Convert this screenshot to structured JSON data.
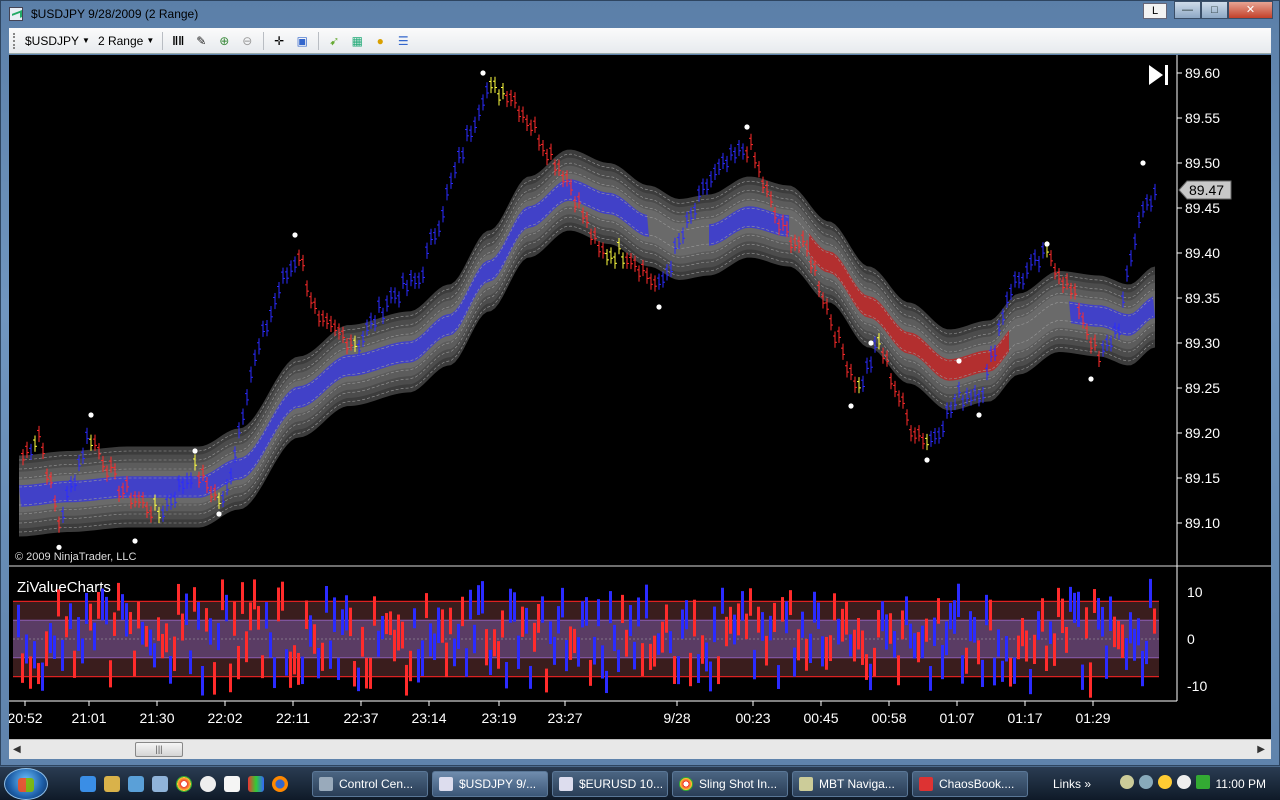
{
  "window": {
    "title": "$USDJPY  9/28/2009 (2 Range)",
    "layout_btn": "L",
    "min_symbol": "—",
    "max_symbol": "□",
    "close_symbol": "✕"
  },
  "toolbar": {
    "instrument": "$USDJPY",
    "period": "2 Range",
    "icons": [
      "bar-type-icon",
      "pencil-icon",
      "zoom-in-icon",
      "zoom-out-icon",
      "crosshair-icon",
      "data-box-icon",
      "strategy-icon",
      "indicators-icon",
      "chart-trader-icon",
      "properties-icon"
    ]
  },
  "chart": {
    "copyright": "© 2009 NinjaTrader, LLC",
    "current_price": "89.47",
    "price_ticks": [
      "89.60",
      "89.55",
      "89.50",
      "89.45",
      "89.40",
      "89.35",
      "89.30",
      "89.25",
      "89.20",
      "89.15",
      "89.10"
    ],
    "price_tick_values": [
      89.6,
      89.55,
      89.5,
      89.45,
      89.4,
      89.35,
      89.3,
      89.25,
      89.2,
      89.15,
      89.1
    ],
    "time_labels": [
      "20:52",
      "21:01",
      "21:30",
      "22:02",
      "22:11",
      "22:37",
      "23:14",
      "23:19",
      "23:27",
      "9/28",
      "00:23",
      "00:45",
      "00:58",
      "01:07",
      "01:17",
      "01:29"
    ],
    "indicator_title": "ZiValueCharts",
    "indicator_ticks": [
      "10",
      "0",
      "-10"
    ],
    "indicator_tick_values": [
      10,
      0,
      -10
    ],
    "colors": {
      "up_bar": "#2b2bff",
      "down_bar": "#ff2b2b",
      "neutral_bar": "#ffff40",
      "band_gray": "#6e6e6e",
      "band_blue": "#3a3ad8",
      "band_red": "#c02525",
      "background": "#000000",
      "axis_text": "#ffffff",
      "value_zone": "#5a3c64"
    }
  },
  "scrollbar": {
    "left_arrow": "◀",
    "right_arrow": "▶",
    "thumb": "|||"
  },
  "taskbar": {
    "buttons": [
      {
        "label": "Control Cen...",
        "icon": "settings-icon"
      },
      {
        "label": "$USDJPY  9/...",
        "icon": "chart-icon"
      },
      {
        "label": "$EURUSD  10...",
        "icon": "chart-icon"
      },
      {
        "label": "Sling Shot In...",
        "icon": "chrome-icon"
      },
      {
        "label": "MBT Naviga...",
        "icon": "navigator-icon"
      },
      {
        "label": "ChaosBook....",
        "icon": "pdf-icon"
      }
    ],
    "links": "Links",
    "links_arrows": "»",
    "clock": "11:00 PM"
  }
}
